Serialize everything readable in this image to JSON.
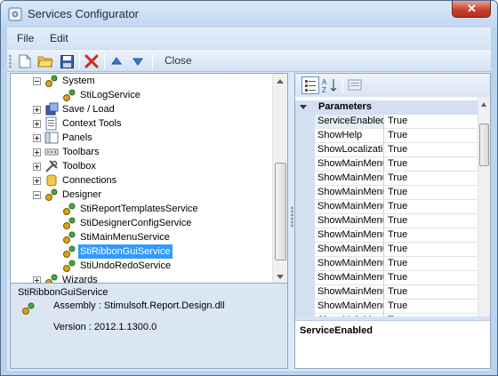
{
  "window": {
    "title": "Services Configurator"
  },
  "menu": {
    "items": [
      "File",
      "Edit"
    ]
  },
  "toolbar": {
    "buttons": [
      "new-document-icon",
      "open-folder-icon",
      "save-icon",
      "delete-icon",
      "move-up-icon",
      "move-down-icon"
    ],
    "close_label": "Close"
  },
  "tree": {
    "nodes": [
      {
        "label": "System",
        "level": 1,
        "expander": "minus",
        "icon": "service-gear-icon"
      },
      {
        "label": "StiLogService",
        "level": 2,
        "icon": "service-gear-icon"
      },
      {
        "label": "Save / Load",
        "level": 1,
        "expander": "plus",
        "icon": "save-load-icon"
      },
      {
        "label": "Context Tools",
        "level": 1,
        "expander": "plus",
        "icon": "context-tools-icon"
      },
      {
        "label": "Panels",
        "level": 1,
        "expander": "plus",
        "icon": "panels-icon"
      },
      {
        "label": "Toolbars",
        "level": 1,
        "expander": "plus",
        "icon": "toolbars-icon"
      },
      {
        "label": "Toolbox",
        "level": 1,
        "expander": "plus",
        "icon": "toolbox-icon"
      },
      {
        "label": "Connections",
        "level": 1,
        "expander": "plus",
        "icon": "database-icon"
      },
      {
        "label": "Designer",
        "level": 1,
        "expander": "minus",
        "icon": "service-gear-icon"
      },
      {
        "label": "StiReportTemplatesService",
        "level": 2,
        "icon": "service-gear-icon"
      },
      {
        "label": "StiDesignerConfigService",
        "level": 2,
        "icon": "service-gear-icon"
      },
      {
        "label": "StiMainMenuService",
        "level": 2,
        "icon": "service-gear-icon"
      },
      {
        "label": "StiRibbonGuiService",
        "level": 2,
        "icon": "service-gear-icon",
        "selected": true
      },
      {
        "label": "StiUndoRedoService",
        "level": 2,
        "icon": "service-gear-icon"
      },
      {
        "label": "Wizards",
        "level": 1,
        "expander": "plus",
        "icon": "service-gear-icon"
      }
    ]
  },
  "info": {
    "title": "StiRibbonGuiService",
    "assembly": "Assembly : Stimulsoft.Report.Design.dll",
    "version": "Version : 2012.1.1300.0"
  },
  "properties": {
    "category": "Parameters",
    "rows": [
      {
        "name": "ServiceEnabled",
        "value": "True",
        "selected": true
      },
      {
        "name": "ShowHelp",
        "value": "True"
      },
      {
        "name": "ShowLocalization",
        "value": "True"
      },
      {
        "name": "ShowMainMenu",
        "value": "True"
      },
      {
        "name": "ShowMainMenu",
        "value": "True"
      },
      {
        "name": "ShowMainMenu",
        "value": "True"
      },
      {
        "name": "ShowMainMenu",
        "value": "True"
      },
      {
        "name": "ShowMainMenu",
        "value": "True"
      },
      {
        "name": "ShowMainMenu",
        "value": "True"
      },
      {
        "name": "ShowMainMenu",
        "value": "True"
      },
      {
        "name": "ShowMainMenu",
        "value": "True"
      },
      {
        "name": "ShowMainMenu",
        "value": "True"
      },
      {
        "name": "ShowMainMenu",
        "value": "True"
      },
      {
        "name": "ShowMainMenu",
        "value": "True"
      },
      {
        "name": "ShowMainMenu",
        "value": "True"
      }
    ],
    "description_title": "ServiceEnabled"
  }
}
